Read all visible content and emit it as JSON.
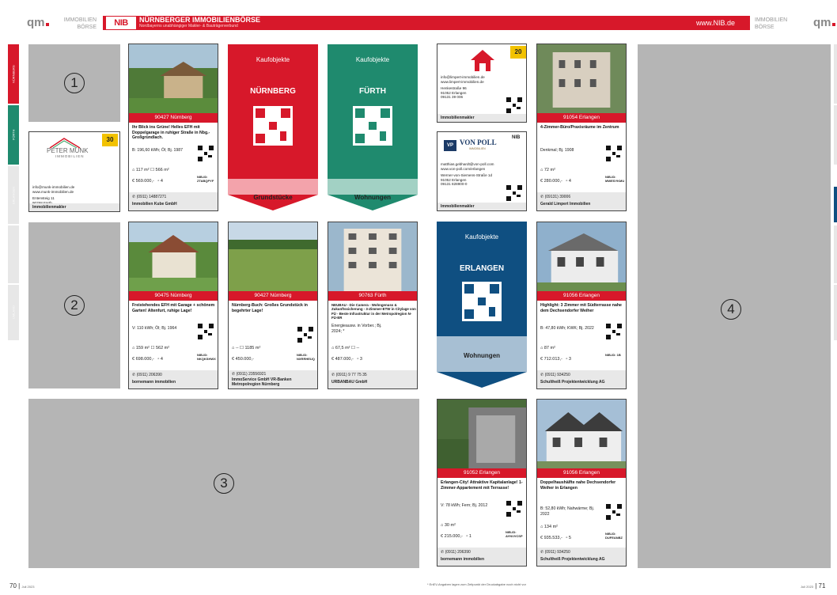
{
  "header": {
    "left_logo": "qm",
    "left_brand_line1": "IMMOBILIEN",
    "left_brand_line2": "BÖRSE",
    "nib_logo": "NIB",
    "title": "NÜRNBERGER IMMOBILIENBÖRSE",
    "subtitle": "Nordbayerns unabhängiger Makler- & Bauträgerverbund",
    "url": "www.NIB.de",
    "right_brand_line1": "IMMOBILIEN",
    "right_brand_line2": "BÖRSE",
    "right_logo": "qm",
    "accent": "#d7182a"
  },
  "side_tabs": [
    {
      "label": "NÜRNBERG",
      "color": "#d7182a"
    },
    {
      "label": "FÜRTH",
      "color": "#1f8a6e"
    },
    {
      "label": "ERLANGEN",
      "color": "#e7e7e7"
    },
    {
      "label": "",
      "color": "#e7e7e7"
    },
    {
      "label": "UMLAND",
      "color": "#e7e7e7"
    }
  ],
  "placeholders": [
    "1",
    "2",
    "3",
    "4"
  ],
  "banners": [
    {
      "head": "Kaufobjekte",
      "city": "NÜRNBERG",
      "bottom": "Grundstücke",
      "color": "#d7182a",
      "bottom_color": "#f3a3ab"
    },
    {
      "head": "Kaufobjekte",
      "city": "FÜRTH",
      "bottom": "Wohnungen",
      "color": "#1f8a6e",
      "bottom_color": "#a2d1c4"
    },
    {
      "head": "Kaufobjekte",
      "city": "ERLANGEN",
      "bottom": "Wohnungen",
      "color": "#0f4f81",
      "bottom_color": "#a7bfd3"
    }
  ],
  "brokers": [
    {
      "logo_text": "PETER MUNK",
      "logo_sub": "IMMOBILIEN",
      "badge": "30",
      "lines": [
        "info@munk-immobilien.de",
        "www.munk-immobilien.de",
        "",
        "Entensteig 11",
        "90768 Fürth",
        "0911 722282"
      ],
      "footer": "Immobilienmakler"
    },
    {
      "logo_text": "",
      "badge": "20",
      "lines": [
        "info@limpert-immobilien.de",
        "www.limpert-immobilien.de",
        "",
        "Henkestraße 96",
        "91052 Erlangen",
        "09131 39 006"
      ],
      "footer": "Immobilienmakler"
    },
    {
      "logo_text": "VON POLL",
      "logo_sub": "IMMOBILIEN",
      "badge": "NIB",
      "lines": [
        "matthias.gebhardt@von-poll.com",
        "www.von-poll.com/erlangen",
        "",
        "Werner-von-Siemens-Straße 1d",
        "91052 Erlangen",
        "09131 828900-0"
      ],
      "footer": "Immobilienmakler"
    }
  ],
  "listings": [
    {
      "loc": "90427 Nürnberg",
      "title": "Ihr Blick ins Grüne! Helles EFH mit Doppelgarage in ruhiger Straße in Nbg.-Großgründlach.",
      "energy": "B: 196,60 kWh; Öl; Bj. 1987",
      "area": "117 m²  ☐ 566 m²",
      "price": "€ 569.000,-",
      "rooms": "4",
      "nib": "NIB-ID: ZTABQPYF",
      "phone": "(0911) 14887271",
      "agent": "Immobilien Kube GmbH"
    },
    {
      "loc": "91054 Erlangen",
      "title": "4-Zimmer-Büro/Praxisräume im Zentrum",
      "energy": "Denkmal; Bj. 1908",
      "area": "72 m²",
      "price": "€ 280.000,-",
      "rooms": "4",
      "nib": "NIB-ID: MWESYKMU",
      "phone": "(09131) 39006",
      "agent": "Gerald Limpert Immobilien"
    },
    {
      "loc": "90475 Nürnberg",
      "title": "Freistehendes EFH mit Garage + schönem Garten! Altenfurt, ruhige Lage!",
      "energy": "V: 110 kWh; Öl; Bj. 1964",
      "area": "159 m²  ☐ 562 m²",
      "price": "€ 698.000,-",
      "rooms": "4",
      "nib": "NIB-ID: NKQKSHWX",
      "phone": "(0911) 206390",
      "agent": "bornemann immobilien"
    },
    {
      "loc": "90427 Nürnberg",
      "title": "Nürnberg-Buch: Großes Grundstück in begehrter Lage!",
      "energy": "",
      "area": "--  ☐ 1185 m²",
      "price": "€ 450.000,-",
      "rooms": "",
      "nib": "NIB-ID: NXRRHEUQ",
      "phone": "(0911) 23556921",
      "agent": "ImmoService GmbH VR-Banken Metropolregion Nürnberg"
    },
    {
      "loc": "90763 Fürth",
      "title": "NEUBAU - Die Camera - Wohngenuss & Zukunftssicherung - 3-Zimmer-ETW in Citylage von FÜ - Beste Infrastruktur in der Metropolregion N-FÜ-ER",
      "energy": "Energieausw. in Vorber.; Bj. 2024; *",
      "area": "67,5 m²  ☐ --",
      "price": "€ 487.000,-",
      "rooms": "3",
      "nib": "",
      "phone": "(0911) 9 77 75 35",
      "agent": "URBANBAU GmbH"
    },
    {
      "loc": "91056 Erlangen",
      "title": "Highlight: 3 Zimmer mit Südterrasse nahe dem Dechsendorfer Weiher",
      "energy": "B: 47,80 kWh; KWK; Bj. 2022",
      "area": "87 m²",
      "price": "€ 712.013,-",
      "rooms": "3",
      "nib": "NIB-ID: 1B",
      "phone": "(0911) 934250",
      "agent": "Schultheiß Projektentwicklung AG"
    },
    {
      "loc": "91052 Erlangen",
      "title": "Erlangen-City! Attraktive Kapitalanlage! 1-Zimmer-Appartement mit Terrasse!",
      "energy": "V: 78 kWh; Fern; Bj. 2012",
      "area": "30 m²",
      "price": "€ 215.000,-",
      "rooms": "1",
      "nib": "NIB-ID: AYNVVCSP",
      "phone": "(0911) 206390",
      "agent": "bornemann immobilien"
    },
    {
      "loc": "91056 Erlangen",
      "title": "Doppelhaushälfte nahe Dechsendorfer Weiher in Erlangen",
      "energy": "B: 52,80 kWh; Nahwärme; Bj. 2022",
      "area": "134 m²",
      "price": "€ 935.533,-",
      "rooms": "5",
      "nib": "NIB-ID: DUFEANBZ",
      "phone": "(0911) 934250",
      "agent": "Schultheiß Projektentwicklung AG"
    }
  ],
  "footer": {
    "left_page": "70",
    "left_date": "Juli 2023",
    "note": "* EnEV-Angaben lagen zum Zeitpunkt der Druckabgabe noch nicht vor",
    "right_date": "Juli 2023",
    "right_page": "71"
  }
}
